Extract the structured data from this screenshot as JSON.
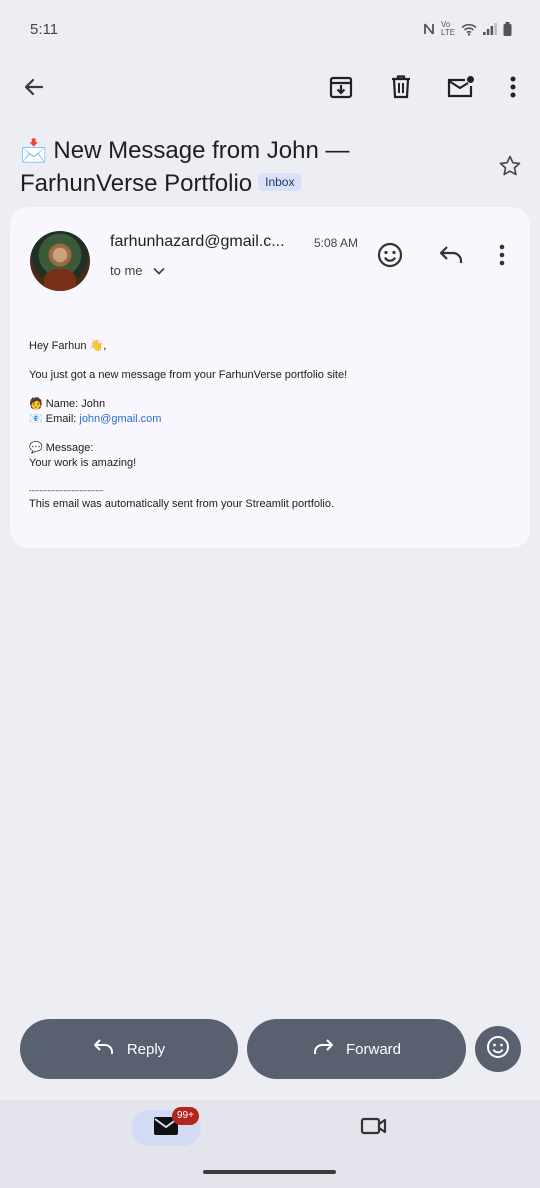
{
  "status_bar": {
    "time": "5:11",
    "volte": "Vo LTE"
  },
  "toolbar": {
    "back_icon": "arrow-left-icon",
    "archive_icon": "archive-icon",
    "delete_icon": "trash-icon",
    "mark_unread_icon": "mail-unread-icon",
    "more_icon": "more-vert-icon"
  },
  "email": {
    "subject_emoji": "📩",
    "subject": "New Message from John — FarhunVerse Portfolio",
    "label": "Inbox",
    "sender": "farhunhazard@gmail.c...",
    "time": "5:08 AM",
    "recipient": "to me",
    "body": {
      "greeting": "Hey Farhun 👋,",
      "intro": "You just got a new message from your FarhunVerse portfolio site!",
      "name_line": "🧑 Name: John",
      "email_label": "📧 Email: ",
      "email_value": "john@gmail.com",
      "message_label": "💬 Message:",
      "message_text": "Your work is amazing!",
      "divider": "----------------------------",
      "footer": "This email was automatically sent from your Streamlit portfolio."
    }
  },
  "actions": {
    "reply_label": "Reply",
    "forward_label": "Forward"
  },
  "bottom_nav": {
    "mail_badge": "99+"
  },
  "colors": {
    "background": "#ededf4",
    "card": "#f8f7fd",
    "pill": "#596070",
    "badge": "#b3261e",
    "link": "#2a6fd6"
  }
}
